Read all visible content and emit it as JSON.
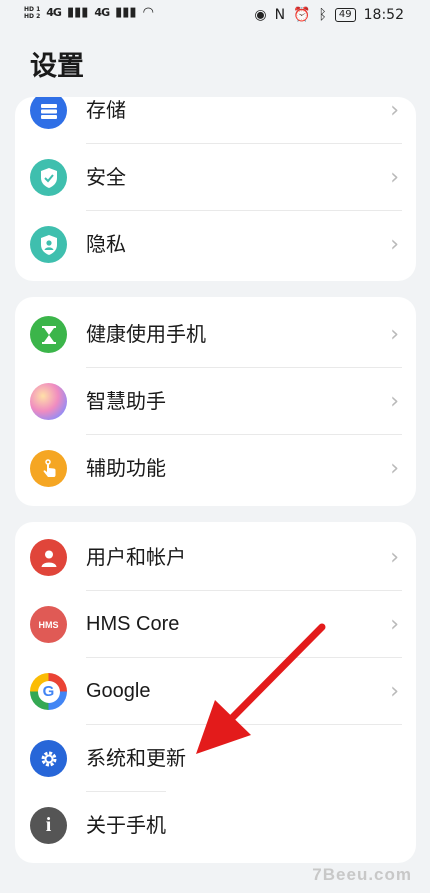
{
  "status_bar": {
    "sim1": "HD 1",
    "sim2": "HD 2",
    "signal1": "4G",
    "signal2": "4G",
    "battery": "49",
    "time": "18:52",
    "icons": [
      "eye-icon",
      "nfc-icon",
      "alarm-icon",
      "bluetooth-icon",
      "battery-icon"
    ]
  },
  "page_title": "设置",
  "groups": [
    [
      {
        "label": "存储",
        "icon": "storage-icon",
        "color": "#2f6fe6"
      },
      {
        "label": "安全",
        "icon": "shield-icon",
        "color": "#3fbfae"
      },
      {
        "label": "隐私",
        "icon": "privacy-icon",
        "color": "#3fbfae"
      }
    ],
    [
      {
        "label": "健康使用手机",
        "icon": "hourglass-icon",
        "color": "#3bb54a"
      },
      {
        "label": "智慧助手",
        "icon": "assistant-icon",
        "color": "#c58be0"
      },
      {
        "label": "辅助功能",
        "icon": "hand-icon",
        "color": "#f5a623"
      }
    ],
    [
      {
        "label": "用户和帐户",
        "icon": "user-icon",
        "color": "#e0453a"
      },
      {
        "label": "HMS Core",
        "icon": "hms-icon",
        "color": "#e05a55"
      },
      {
        "label": "Google",
        "icon": "google-icon",
        "color": "#ffffff"
      },
      {
        "label": "系统和更新",
        "icon": "gear-icon",
        "color": "#2766d8"
      },
      {
        "label": "关于手机",
        "icon": "info-icon",
        "color": "#555555"
      }
    ]
  ],
  "watermark": "7Beeu.com",
  "accent_arrow_color": "#e31b1b"
}
